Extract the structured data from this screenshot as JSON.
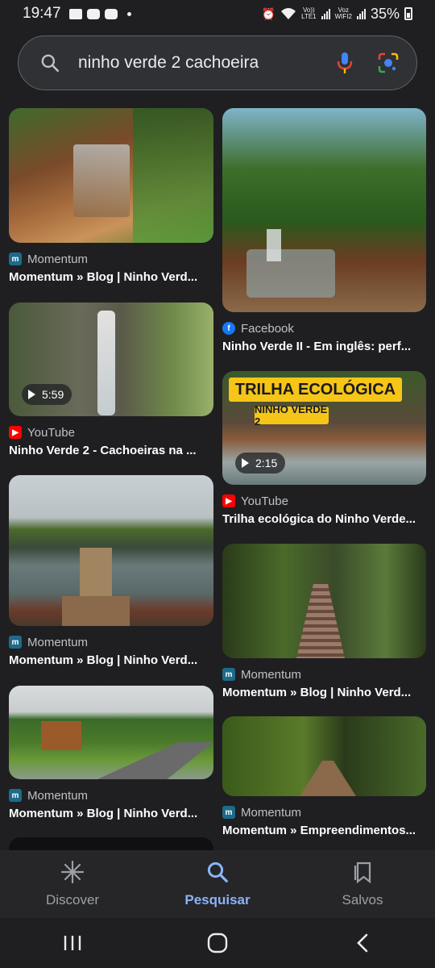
{
  "status": {
    "time": "19:47",
    "battery": "35%",
    "net1_top": "Vo))",
    "net1_bottom": "LTE1",
    "net2_top": "Voz",
    "net2_bottom": "WIFI2"
  },
  "search": {
    "query": "ninho verde 2 cachoeira"
  },
  "results": [
    {
      "source": "Momentum",
      "title": "Momentum » Blog | Ninho Verd..."
    },
    {
      "source": "Facebook",
      "title": "Ninho Verde II - Em inglês: perf..."
    },
    {
      "source": "YouTube",
      "title": "Ninho Verde 2 - Cachoeiras na ...",
      "duration": "5:59"
    },
    {
      "source": "YouTube",
      "title": "Trilha ecológica do Ninho Verde...",
      "duration": "2:15",
      "banner_main": "TRILHA ECOLÓGICA",
      "banner_sub": "NINHO VERDE 2"
    },
    {
      "source": "Momentum",
      "title": "Momentum » Blog | Ninho Verd..."
    },
    {
      "source": "Momentum",
      "title": "Momentum » Blog | Ninho Verd..."
    },
    {
      "source": "Momentum",
      "title": "Momentum » Blog | Ninho Verd..."
    },
    {
      "source": "Momentum",
      "title": "Momentum » Empreendimentos..."
    }
  ],
  "nav": {
    "discover": "Discover",
    "search": "Pesquisar",
    "saved": "Salvos"
  },
  "colors": {
    "accent": "#8ab4f8",
    "background": "#1f1f21",
    "momentum": "#1e6a8a",
    "facebook": "#1877f2",
    "youtube": "#ff0000"
  }
}
